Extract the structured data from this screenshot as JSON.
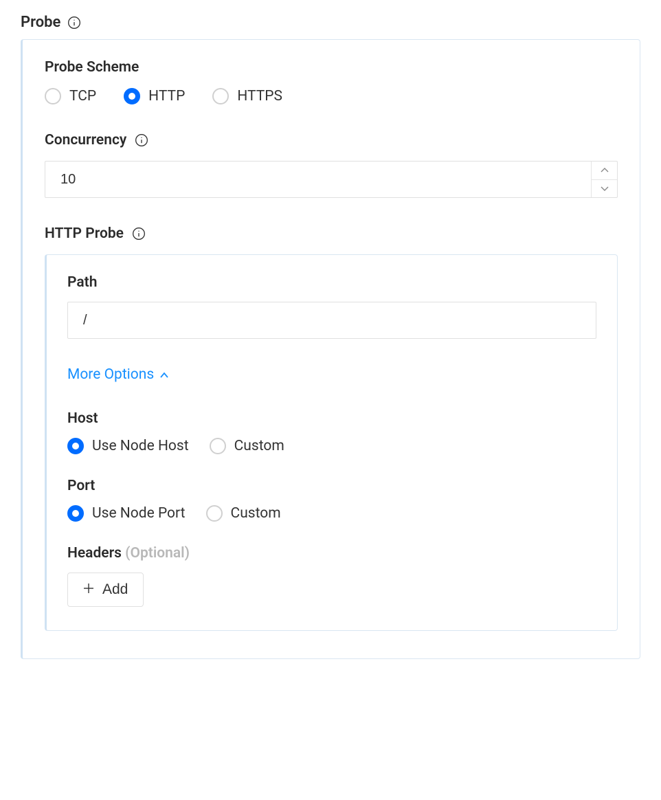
{
  "title": "Probe",
  "schemeLabel": "Probe Scheme",
  "schemeOptions": {
    "tcp": "TCP",
    "http": "HTTP",
    "https": "HTTPS"
  },
  "concurrency": {
    "label": "Concurrency",
    "value": "10"
  },
  "httpProbe": {
    "label": "HTTP Probe",
    "pathLabel": "Path",
    "pathValue": "/",
    "moreOptions": "More Options",
    "host": {
      "label": "Host",
      "useNode": "Use Node Host",
      "custom": "Custom"
    },
    "port": {
      "label": "Port",
      "useNode": "Use Node Port",
      "custom": "Custom"
    },
    "headers": {
      "label": "Headers",
      "optional": "(Optional)",
      "add": "Add"
    }
  }
}
